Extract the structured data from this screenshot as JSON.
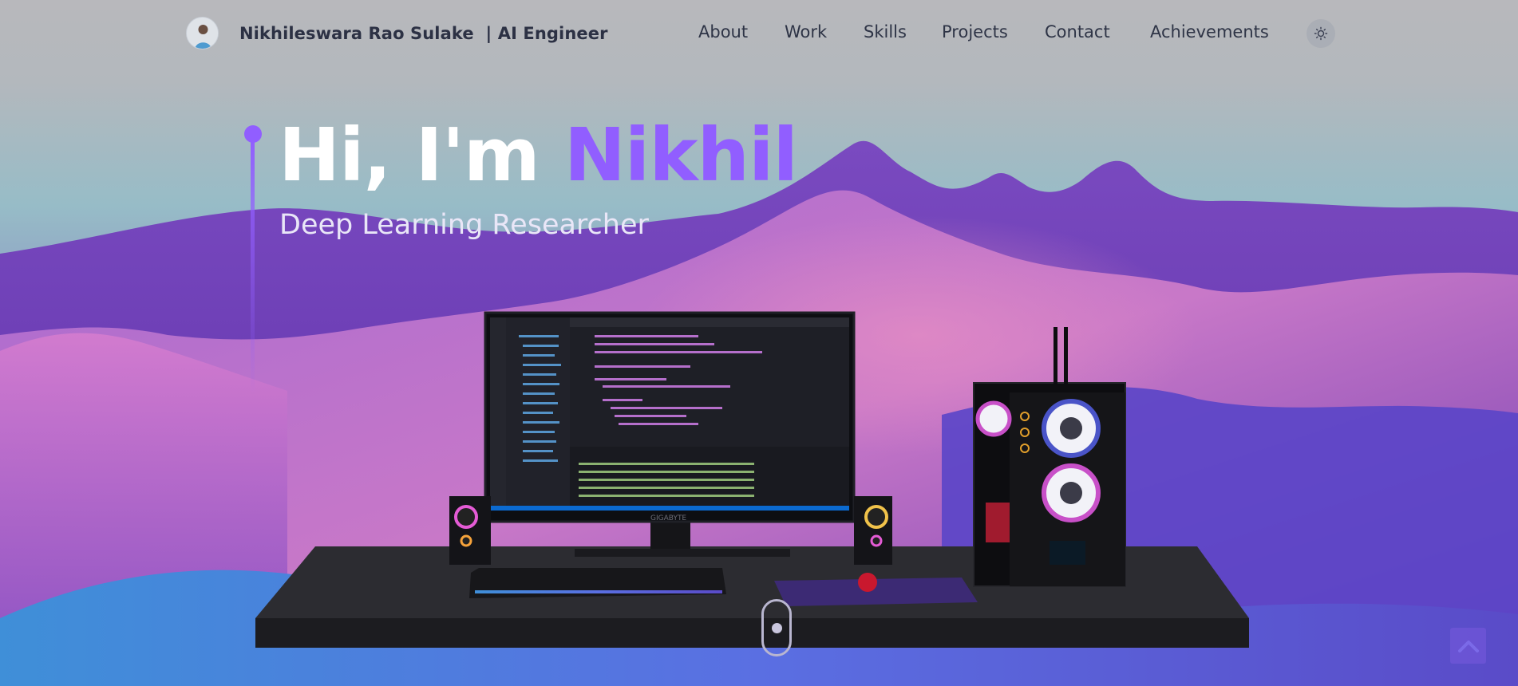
{
  "header": {
    "brand_name": "Nikhileswara Rao Sulake",
    "brand_separator": "|",
    "brand_role": "AI Engineer",
    "nav_items": [
      "About",
      "Work",
      "Skills",
      "Projects",
      "Contact",
      "Achievements"
    ],
    "theme_toggle_icon": "sun-icon"
  },
  "hero": {
    "greeting": "Hi, I'm",
    "name": "Nikhil",
    "subtitle": "Deep Learning Researcher"
  },
  "scene": {
    "monitor_brand": "GIGABYTE"
  },
  "colors": {
    "accent": "#915eff",
    "nav_text": "#2e3446",
    "sky_top": "#b9b9bd",
    "sky_mid": "#8fbcc9",
    "mountain_purple": "#5a2ea6",
    "mountain_pink": "#d57fd0",
    "floor_blue": "#4f6fd6"
  },
  "icons": {
    "scroll_indicator": "mouse-scroll-icon",
    "back_to_top": "chevron-up-icon"
  }
}
